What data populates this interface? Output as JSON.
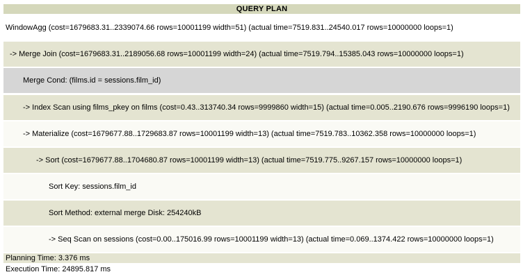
{
  "header": {
    "title": "QUERY PLAN"
  },
  "rows": [
    {
      "text": "WindowAgg  (cost=1679683.31..2339074.66 rows=10001199 width=51) (actual time=7519.831..24540.017 rows=10000000 loops=1)"
    },
    {
      "text": "->  Merge Join  (cost=1679683.31..2189056.68 rows=10001199 width=24) (actual time=7519.794..15385.043 rows=10000000 loops=1)"
    },
    {
      "text": "Merge Cond: (films.id = sessions.film_id)"
    },
    {
      "text": "->  Index Scan using films_pkey on films  (cost=0.43..313740.34 rows=9999860 width=15) (actual time=0.005..2190.676 rows=9996190 loops=1)"
    },
    {
      "text": "->  Materialize  (cost=1679677.88..1729683.87 rows=10001199 width=13) (actual time=7519.783..10362.358 rows=10000000 loops=1)"
    },
    {
      "text": "->  Sort  (cost=1679677.88..1704680.87 rows=10001199 width=13) (actual time=7519.775..9267.157 rows=10000000 loops=1)"
    },
    {
      "text": "Sort Key: sessions.film_id"
    },
    {
      "text": "Sort Method: external merge  Disk: 254240kB"
    },
    {
      "text": "->  Seq Scan on sessions  (cost=0.00..175016.99 rows=10001199 width=13) (actual time=0.069..1374.422 rows=10000000 loops=1)"
    }
  ],
  "footer": {
    "planning_time": "Planning Time: 3.376 ms",
    "execution_time": "Execution Time: 24895.817 ms"
  },
  "colors": {
    "header_bg": "#d5d8bb",
    "row_alt_bg": "#e4e4d1",
    "row_highlight_bg": "#d6d6d6"
  }
}
